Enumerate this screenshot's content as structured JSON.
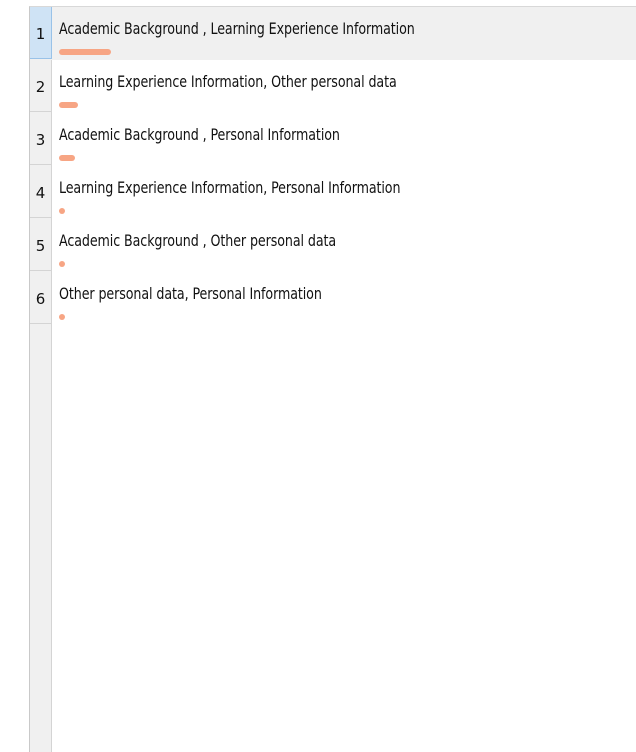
{
  "list": {
    "selected_index": 0,
    "bar_color": "#f7a584",
    "items": [
      {
        "number": "1",
        "label": "Academic Background , Learning Experience Information",
        "score": 1.0
      },
      {
        "number": "2",
        "label": "Learning Experience Information, Other personal data",
        "score": 0.36
      },
      {
        "number": "3",
        "label": "Academic Background , Personal Information",
        "score": 0.3
      },
      {
        "number": "4",
        "label": "Learning Experience Information, Personal Information",
        "score": 0.12
      },
      {
        "number": "5",
        "label": "Academic Background , Other personal data",
        "score": 0.1
      },
      {
        "number": "6",
        "label": "Other personal data, Personal Information",
        "score": 0.1
      }
    ]
  }
}
